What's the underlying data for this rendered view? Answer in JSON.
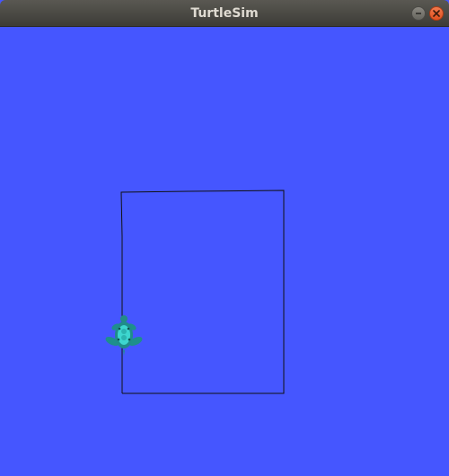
{
  "window": {
    "title": "TurtleSim"
  },
  "titlebar": {
    "buttons": [
      {
        "name": "minimize",
        "icon": "minimize-icon"
      },
      {
        "name": "close",
        "icon": "close-icon"
      }
    ]
  },
  "canvas": {
    "background": "#4556ff",
    "pen_color": "#000000",
    "turtle_icon": "turtle-icon",
    "turtle_color": "#2bb5b0"
  }
}
